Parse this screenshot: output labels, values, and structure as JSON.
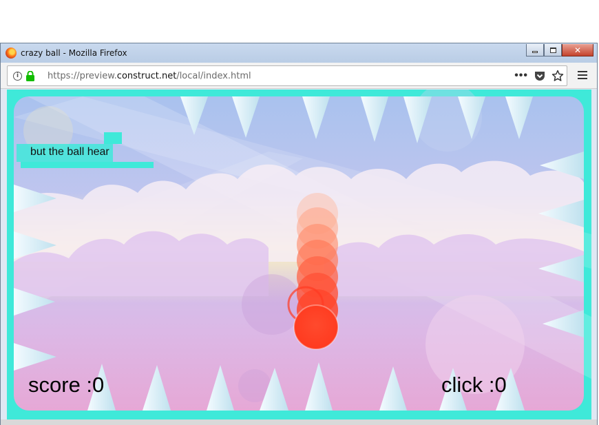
{
  "window": {
    "title": "crazy ball - Mozilla Firefox",
    "controls": [
      "minimize",
      "maximize",
      "close"
    ]
  },
  "browser": {
    "url_prefix": "https://preview.",
    "url_domain": "construct.net",
    "url_path": "/local/index.html",
    "icons": [
      "info-icon",
      "lock-icon",
      "more-icon",
      "pocket-icon",
      "bookmark-star-icon",
      "menu-icon"
    ]
  },
  "game": {
    "hint": "but the ball hear",
    "score_label": "score :0",
    "click_label": "click :0",
    "colors": {
      "border": "#3fe9d9",
      "ball": "#ff3b22",
      "spike": "#d3ecf4"
    }
  }
}
